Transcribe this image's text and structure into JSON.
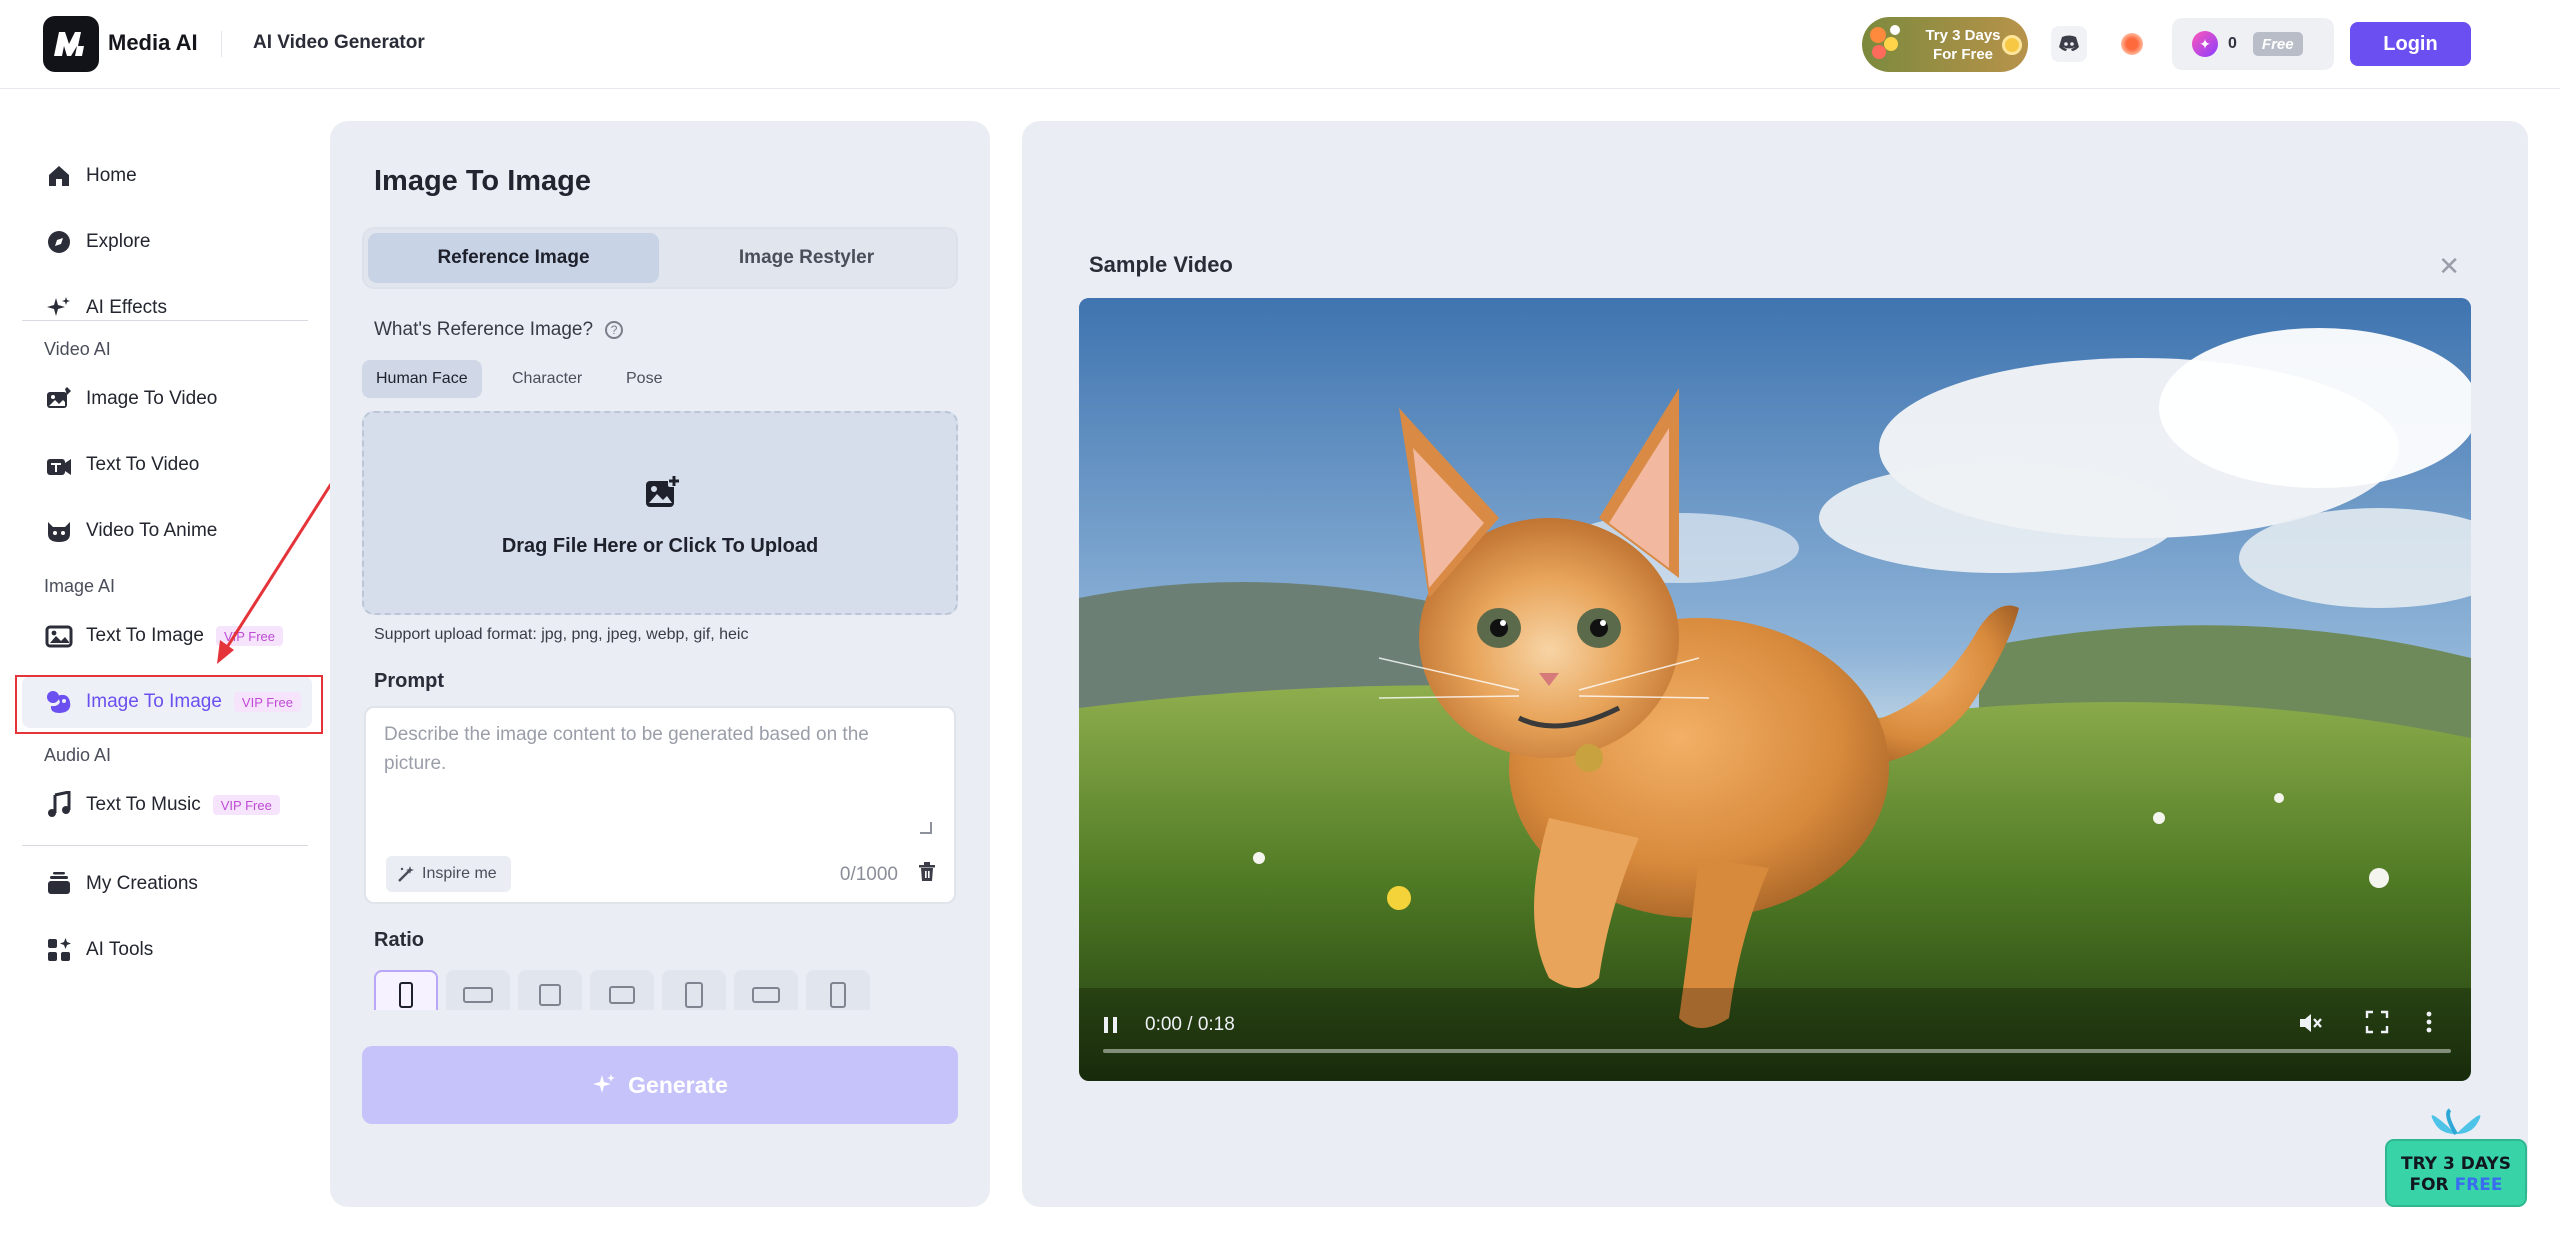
{
  "header": {
    "brand": "Media AI",
    "title": "AI Video Generator",
    "trial_badge": "Try 3 Days For Free",
    "credits": "0",
    "free_tag": "Free",
    "login": "Login"
  },
  "sidebar": {
    "main": [
      {
        "label": "Home"
      },
      {
        "label": "Explore"
      },
      {
        "label": "AI Effects"
      }
    ],
    "video_section": "Video AI",
    "video": [
      {
        "label": "Image To Video"
      },
      {
        "label": "Text To Video"
      },
      {
        "label": "Video To Anime"
      }
    ],
    "image_section": "Image AI",
    "image": [
      {
        "label": "Text To Image",
        "badge": "VIP Free"
      },
      {
        "label": "Image To Image",
        "badge": "VIP Free"
      }
    ],
    "audio_section": "Audio AI",
    "audio": [
      {
        "label": "Text To Music",
        "badge": "VIP Free"
      }
    ],
    "bottom": [
      {
        "label": "My Creations"
      },
      {
        "label": "AI Tools"
      }
    ]
  },
  "panel": {
    "title": "Image To Image",
    "tabs": [
      "Reference Image",
      "Image Restyler"
    ],
    "question": "What's Reference Image?",
    "chips": [
      "Human Face",
      "Character",
      "Pose"
    ],
    "upload_text": "Drag File Here or Click To Upload",
    "support": "Support upload format: jpg, png, jpeg, webp, gif, heic",
    "prompt_label": "Prompt",
    "prompt_placeholder": "Describe the image content to be generated based on the picture.",
    "inspire": "Inspire me",
    "count": "0/1000",
    "ratio_label": "Ratio",
    "generate": "Generate"
  },
  "preview": {
    "title": "Sample Video",
    "time": "0:00 / 0:18"
  },
  "floating": {
    "line1": "TRY 3 DAYS",
    "line2_a": "FOR ",
    "line2_b": "FREE"
  },
  "colors": {
    "accent": "#6b4ff0",
    "vip_text": "#c04ad6",
    "highlight": "#e5333a"
  }
}
